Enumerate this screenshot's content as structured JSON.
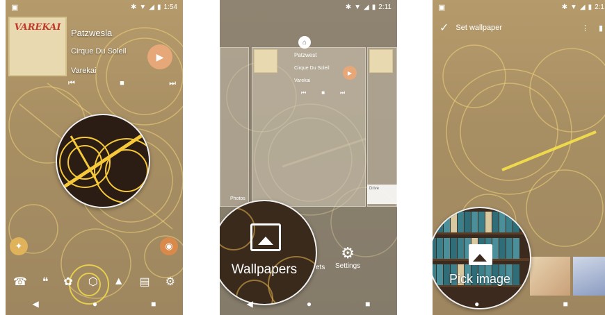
{
  "phone1": {
    "status": {
      "time": "1:54"
    },
    "widget": {
      "album_title": "VAREKAI",
      "track": "Patzwesla",
      "artist": "Cirque Du Soleil",
      "album": "Varekai"
    },
    "navbar": {
      "back": "◀",
      "home": "●",
      "recents": "■"
    }
  },
  "phone2": {
    "status": {
      "time": "2:11"
    },
    "preview": {
      "track": "Patzwest",
      "artist": "Cirque Du Soleil",
      "album": "Varekai",
      "drive_label": "Drive",
      "left_label": "Photos"
    },
    "options": {
      "wallpapers_label": "Wallpapers",
      "widgets_partial": "ets",
      "settings_label": "Settings"
    },
    "navbar": {
      "back": "◀",
      "home": "●",
      "recents": "■"
    }
  },
  "phone3": {
    "status": {
      "time": "2:1"
    },
    "topbar": {
      "title": "Set wallpaper"
    },
    "pick_label": "Pick image",
    "navbar": {
      "home": "●",
      "recents": "■"
    }
  },
  "colors": {
    "accent": "#e6a879",
    "gear_glow": "#f6e04a",
    "wall": "#a88f63"
  }
}
